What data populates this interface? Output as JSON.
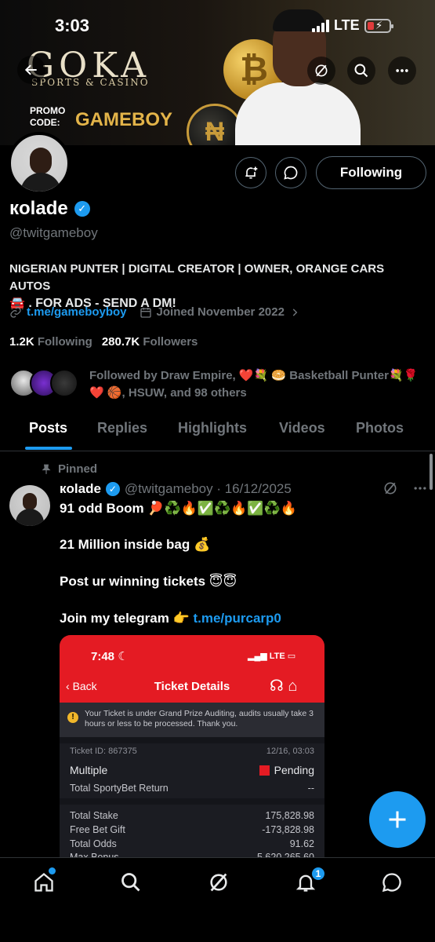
{
  "status_bar": {
    "time": "3:03",
    "network": "LTE"
  },
  "banner": {
    "brand": "GOKA",
    "brand_sub": "SPORTS & CASINO",
    "promo_label": "PROMO\nCODE:",
    "promo_code": "GAMEBOY"
  },
  "profile": {
    "display_name": "кoladе",
    "handle": "@twitgameboy",
    "bio_line1": "NIGERIAN PUNTER | DIGITAL CREATOR | OWNER, ORANGE CARS AUTOS",
    "bio_line2": "🚘 . FOR ADS - SEND A DM!",
    "link": "t.me/gameboyboy",
    "joined": "Joined November 2022",
    "following_count": "1.2K",
    "following_label": "Following",
    "followers_count": "280.7K",
    "followers_label": "Followers",
    "followed_by": "Followed by Draw Empire, ❤️💐 🥯 Basketball Punter💐🌹❤️ 🏀, HSUW, and 98 others",
    "follow_button": "Following"
  },
  "tabs": [
    "Posts",
    "Replies",
    "Highlights",
    "Videos",
    "Photos"
  ],
  "active_tab": "Posts",
  "post": {
    "pinned_label": "Pinned",
    "author": "кoladе",
    "handle_date": "@twitgameboy · 16/12/2025",
    "line1": "91 odd Boom 🏓♻️🔥✅♻️🔥✅♻️🔥",
    "line2": "21 Million inside bag 💰",
    "line3": "Post ur winning tickets 😇😇",
    "line4_text": "Join my telegram 👉 ",
    "line4_link": "t.me/purcarp0"
  },
  "ticket": {
    "time": "7:48",
    "network": "LTE",
    "back": "Back",
    "title": "Ticket Details",
    "notice": "Your Ticket is under Grand Prize Auditing, audits usually take 3 hours or less to be processed. Thank you.",
    "ticket_id": "Ticket ID: 867375",
    "ticket_date": "12/16, 03:03",
    "bet_type": "Multiple",
    "status": "Pending",
    "return_label": "Total SportyBet Return",
    "return_value": "--",
    "stake_label": "Total Stake",
    "stake_value": "175,828.98",
    "gift_label": "Free Bet Gift",
    "gift_value": "-173,828.98",
    "odds_label": "Total Odds",
    "odds_value": "91.62",
    "bonus_label": "Max Bonus",
    "bonus_value": "5,620,265.60"
  },
  "colors": {
    "accent": "#1d9bf0",
    "background": "#000000",
    "secondary_text": "#71767b",
    "ticket_red": "#e41b23"
  },
  "notifications_badge": "1"
}
